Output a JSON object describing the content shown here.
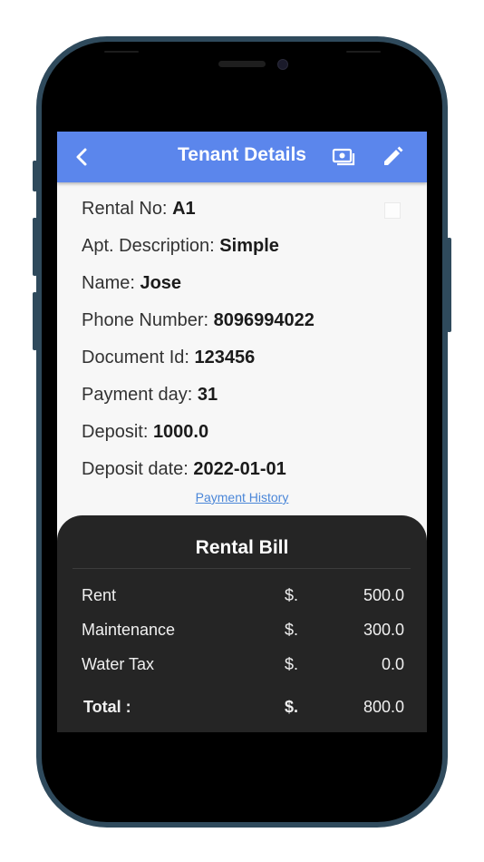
{
  "app_bar": {
    "title": "Tenant Details",
    "back_icon": "chevron-left-icon",
    "money_icon": "cash-icon",
    "edit_icon": "pencil-icon",
    "color": "#5b86ec"
  },
  "details": [
    {
      "label": "Rental No:",
      "value": "A1"
    },
    {
      "label": "Apt. Description:",
      "value": "Simple"
    },
    {
      "label": "Name:",
      "value": "Jose"
    },
    {
      "label": "Phone Number:",
      "value": "8096994022"
    },
    {
      "label": "Document Id:",
      "value": "123456"
    },
    {
      "label": "Payment day:",
      "value": "31"
    },
    {
      "label": "Deposit:",
      "value": "1000.0"
    },
    {
      "label": "Deposit date:",
      "value": "2022-01-01"
    }
  ],
  "payment_history_link": "Payment History",
  "bill": {
    "title": "Rental Bill",
    "rows": [
      {
        "item": "Rent",
        "currency": "$.",
        "amount": "500.0"
      },
      {
        "item": "Maintenance",
        "currency": "$.",
        "amount": "300.0"
      },
      {
        "item": "Water Tax",
        "currency": "$.",
        "amount": "0.0"
      }
    ],
    "total": {
      "item": "Total :",
      "currency": "$.",
      "amount": "800.0"
    }
  }
}
